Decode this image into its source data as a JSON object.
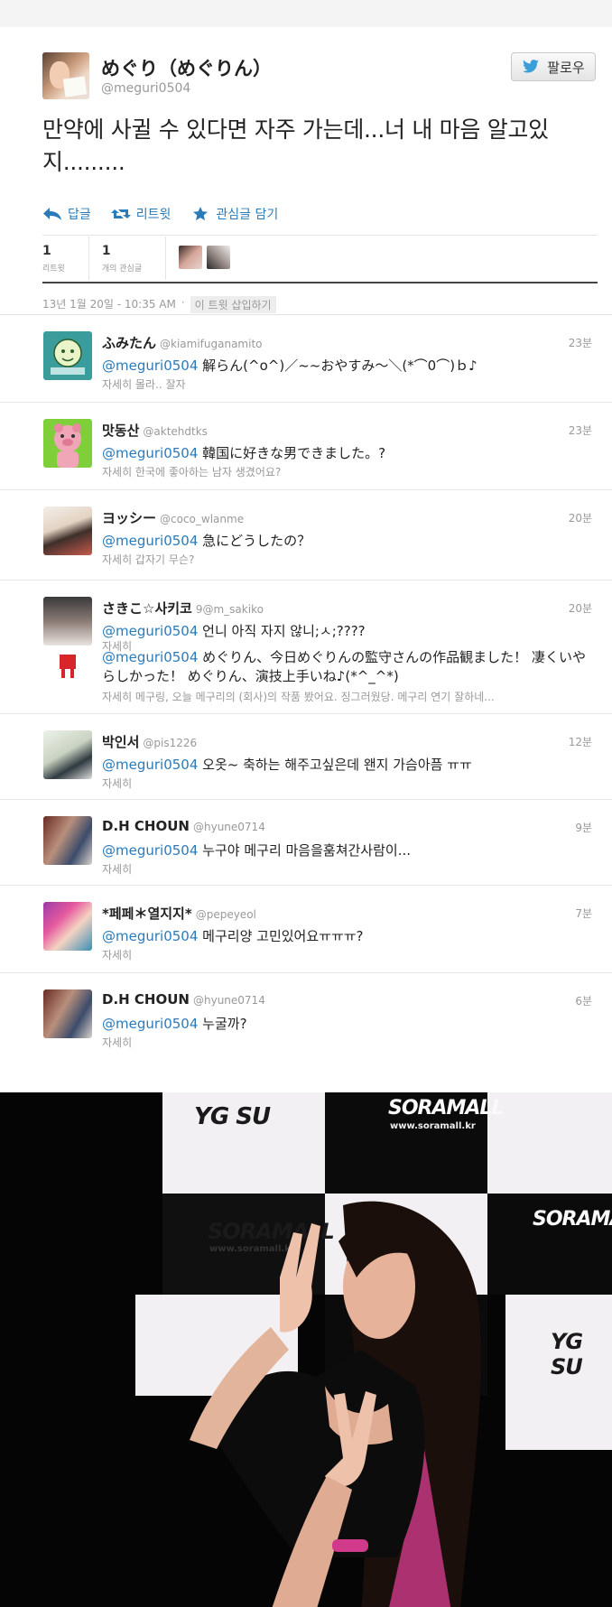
{
  "tweet": {
    "display_name": "めぐり（めぐりん）",
    "screen_name": "@meguri0504",
    "follow_label": "팔로우",
    "text": "만약에 사귈 수 있다면 자주 가는데...너 내 마음 알고있지.........",
    "actions": {
      "reply": "답글",
      "retweet": "리트윗",
      "favorite": "관심글 담기"
    },
    "stats": [
      {
        "count": "1",
        "label": "리트윗"
      },
      {
        "count": "1",
        "label": "개의 관심글"
      }
    ],
    "timestamp": "13년 1월 20일 - 10:35 AM",
    "separator": "·",
    "embed_label": "이 트윗 삽입하기"
  },
  "replies": [
    {
      "name": "ふみたん",
      "handle": "@kiamifuganamito",
      "time": "23분",
      "mention": "@meguri0504",
      "text": "解らん(^o^)／~~おやすみ～＼(*⌒0⌒)ｂ♪",
      "detail": "자세히 몰라.. 잘자"
    },
    {
      "name": "맛동산",
      "handle": "@aktehdtks",
      "time": "23분",
      "mention": "@meguri0504",
      "text": "韓国に好きな男できました。?",
      "detail": "자세히 한국에 좋아하는 남자 생겼어요?"
    },
    {
      "name": "ヨッシー",
      "handle": "@coco_wlanme",
      "time": "20분",
      "mention": "@meguri0504",
      "text": "急にどうしたの？",
      "detail": "자세히 갑자기 무슨?"
    },
    {
      "name": "さきこ☆사키코",
      "handle": "9@m_sakiko",
      "time": "20분",
      "mention": "@meguri0504",
      "text": "언니 아직 자지 않니;ㅅ;????",
      "detail": "자세히",
      "mention2": "@meguri0504",
      "text2": "めぐりん、今日めぐりんの監守さんの作品観ました！ 凄くいやらしかった！ めぐりん、演技上手いね♪(*^_^*)",
      "detail2": "자세히 메구링, 오늘 메구리의 (회사)의 작품 봤어요. 징그러웠당. 메구리 연기 잘하네..."
    },
    {
      "name": "박인서",
      "handle": "@pis1226",
      "time": "12분",
      "mention": "@meguri0504",
      "text": "오옷~ 축하는 해주고싶은데 왠지 가슴아픔 ㅠㅠ",
      "detail": "자세히"
    },
    {
      "name": "D.H CHOUN",
      "handle": "@hyune0714",
      "time": "9분",
      "mention": "@meguri0504",
      "text": "누구야 메구리 마음을훔쳐간사람이...",
      "detail": "자세히"
    },
    {
      "name": "*페페＊열지지*",
      "handle": "@pepeyeol",
      "time": "7분",
      "mention": "@meguri0504",
      "text": "메구리양 고민있어요ㅠㅠㅠ?",
      "detail": "자세히"
    },
    {
      "name": "D.H CHOUN",
      "handle": "@hyune0714",
      "time": "6분",
      "mention": "@meguri0504",
      "text": "누굴까?",
      "detail": "자세히"
    }
  ],
  "photo": {
    "logos": {
      "ygosu": "YG SU",
      "soramall": "SORAMALL",
      "soramall_url": "www.soramall.kr"
    }
  }
}
